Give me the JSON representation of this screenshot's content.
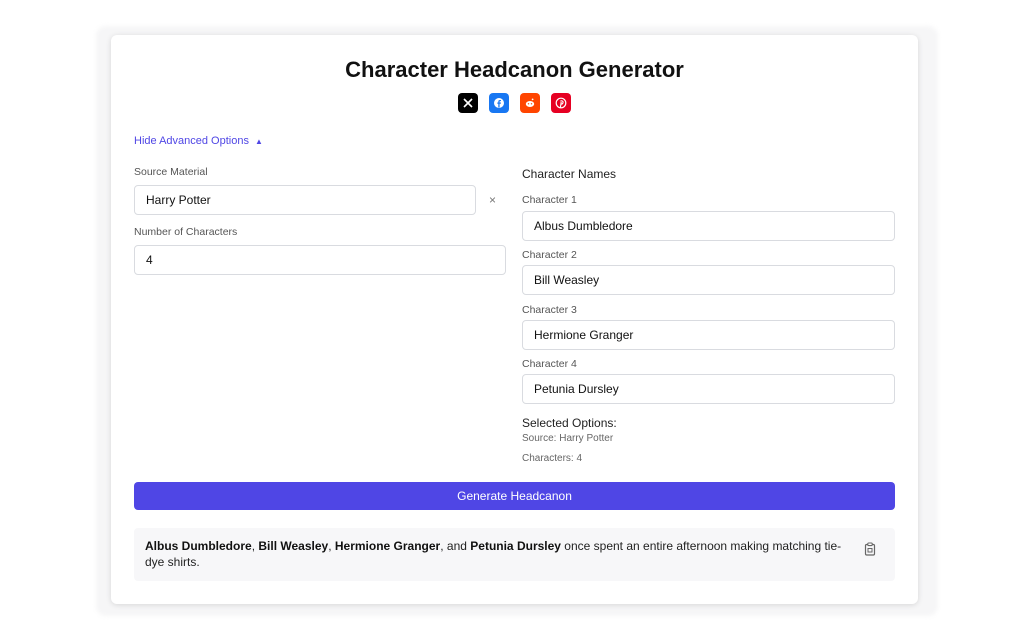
{
  "title": "Character Headcanon Generator",
  "share": [
    {
      "name": "x-icon",
      "color": "#000000"
    },
    {
      "name": "facebook-icon",
      "color": "#1877f2"
    },
    {
      "name": "reddit-icon",
      "color": "#ff4500"
    },
    {
      "name": "pinterest-icon",
      "color": "#e60023"
    }
  ],
  "advanced": {
    "toggle_label": "Hide Advanced Options",
    "toggle_icon": "triangle-up-icon"
  },
  "form": {
    "source_label": "Source Material",
    "source_value": "Harry Potter",
    "clear_label": "×",
    "count_label": "Number of Characters",
    "count_value": "4"
  },
  "characters": {
    "heading": "Character Names",
    "items": [
      {
        "label": "Character 1",
        "value": "Albus Dumbledore"
      },
      {
        "label": "Character 2",
        "value": "Bill Weasley"
      },
      {
        "label": "Character 3",
        "value": "Hermione Granger"
      },
      {
        "label": "Character 4",
        "value": "Petunia Dursley"
      }
    ]
  },
  "selected": {
    "title": "Selected Options:",
    "source_line": "Source: Harry Potter",
    "characters_line": "Characters: 4"
  },
  "generate_label": "Generate Headcanon",
  "result": {
    "names": [
      "Albus Dumbledore",
      "Bill Weasley",
      "Hermione Granger",
      "Petunia Dursley"
    ],
    "sep1": ", ",
    "sep2": ", ",
    "sep3": ", and ",
    "tail": " once spent an entire afternoon making matching tie-dye shirts."
  },
  "colors": {
    "accent": "#4f46e5"
  }
}
